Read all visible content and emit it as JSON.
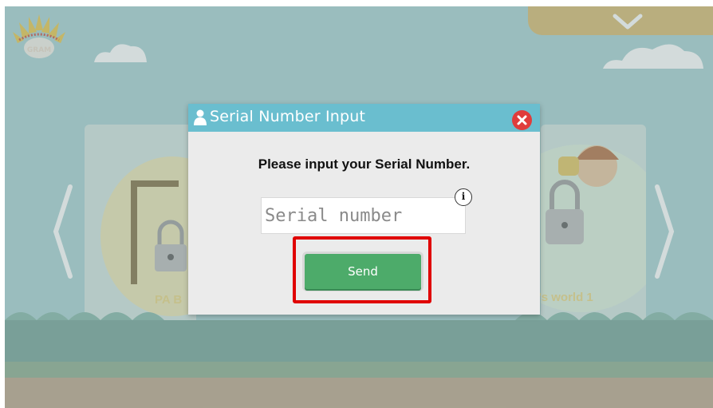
{
  "app": {
    "logo_text": "GRAM"
  },
  "colors": {
    "sky": "#a4cfd0",
    "dialog_header": "#6abecf",
    "send_button": "#4dab6a",
    "close_button": "#e03c3c",
    "highlight": "#e00000",
    "top_tab": "#d6b66a"
  },
  "background_cards": {
    "left_label": "PA B",
    "right_label": "d's world 1"
  },
  "dialog": {
    "title": "Serial Number Input",
    "title_icon": "user-icon",
    "close_icon": "close-icon",
    "message": "Please input your Serial Number.",
    "input": {
      "value": "",
      "placeholder": "Serial number"
    },
    "info_icon_text": "i",
    "send_label": "Send"
  },
  "top_tab": {
    "icon": "chevron-down-icon"
  },
  "nav": {
    "left_icon": "chevron-left-icon",
    "right_icon": "chevron-right-icon"
  }
}
